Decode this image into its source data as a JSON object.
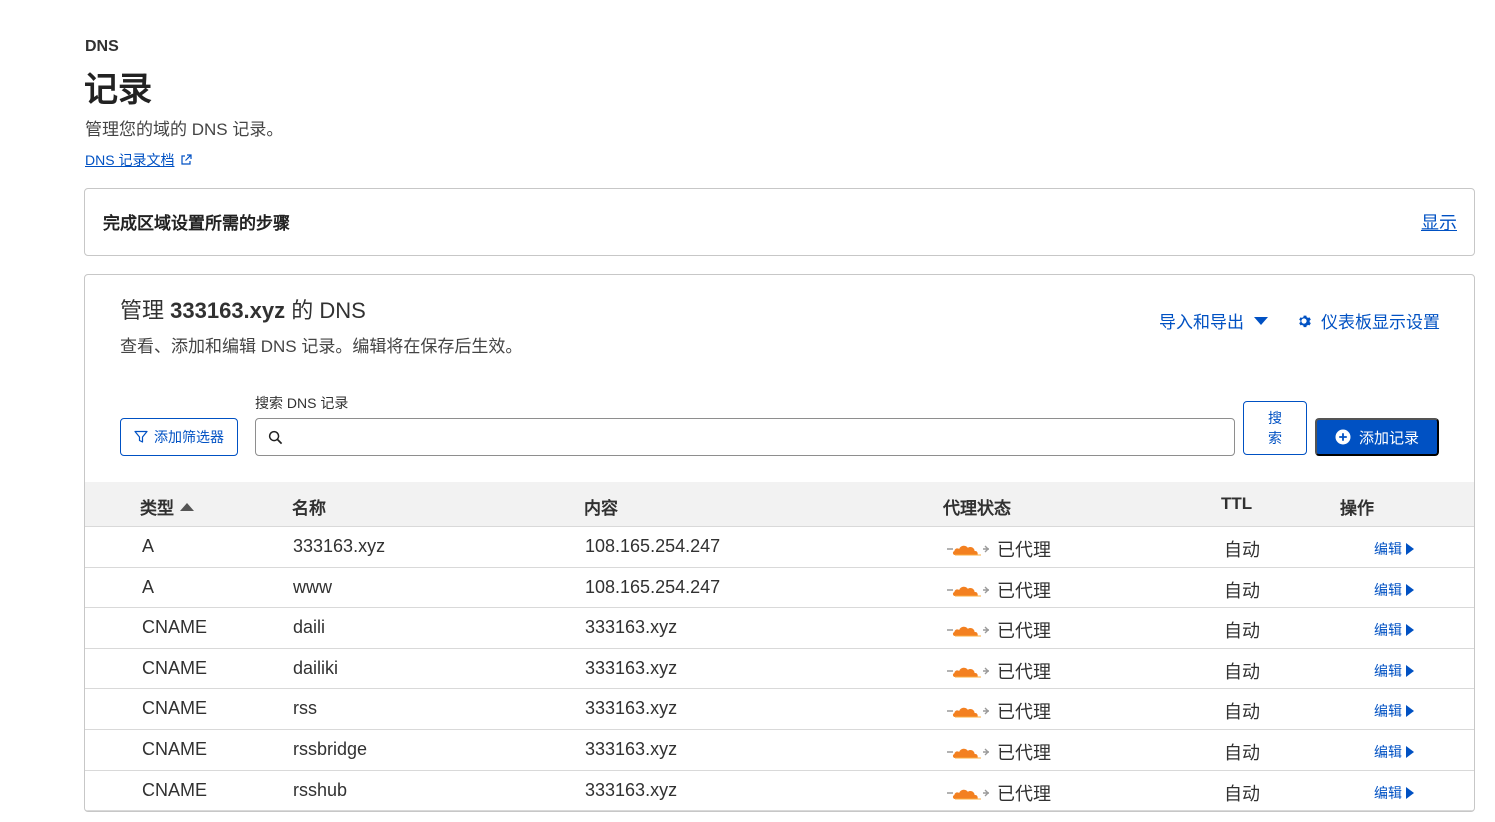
{
  "header": {
    "section": "DNS",
    "title": "记录",
    "description": "管理您的域的 DNS 记录。",
    "doc_link": "DNS 记录文档"
  },
  "setup": {
    "title": "完成区域设置所需的步骤",
    "show": "显示"
  },
  "dns_card": {
    "title_prefix": "管理",
    "domain": "333163.xyz",
    "title_suffix": "的 DNS",
    "subtitle": "查看、添加和编辑 DNS 记录。编辑将在保存后生效。",
    "import_export": "导入和导出",
    "dashboard_settings": "仪表板显示设置",
    "search_label": "搜索 DNS 记录",
    "search_value": "",
    "filter_button": "添加筛选器",
    "search_button": "搜索",
    "add_button": "添加记录"
  },
  "table": {
    "columns": [
      "类型",
      "名称",
      "内容",
      "代理状态",
      "TTL",
      "操作"
    ],
    "rows": [
      {
        "type": "A",
        "name": "333163.xyz",
        "content": "108.165.254.247",
        "proxy": "已代理",
        "ttl": "自动",
        "action": "编辑"
      },
      {
        "type": "A",
        "name": "www",
        "content": "108.165.254.247",
        "proxy": "已代理",
        "ttl": "自动",
        "action": "编辑"
      },
      {
        "type": "CNAME",
        "name": "daili",
        "content": "333163.xyz",
        "proxy": "已代理",
        "ttl": "自动",
        "action": "编辑"
      },
      {
        "type": "CNAME",
        "name": "dailiki",
        "content": "333163.xyz",
        "proxy": "已代理",
        "ttl": "自动",
        "action": "编辑"
      },
      {
        "type": "CNAME",
        "name": "rss",
        "content": "333163.xyz",
        "proxy": "已代理",
        "ttl": "自动",
        "action": "编辑"
      },
      {
        "type": "CNAME",
        "name": "rssbridge",
        "content": "333163.xyz",
        "proxy": "已代理",
        "ttl": "自动",
        "action": "编辑"
      },
      {
        "type": "CNAME",
        "name": "rsshub",
        "content": "333163.xyz",
        "proxy": "已代理",
        "ttl": "自动",
        "action": "编辑"
      }
    ]
  },
  "colors": {
    "accent": "#0051c3",
    "proxy_cloud": "#f38020",
    "border": "#c7c7c7",
    "header_bg": "#f2f2f2"
  }
}
